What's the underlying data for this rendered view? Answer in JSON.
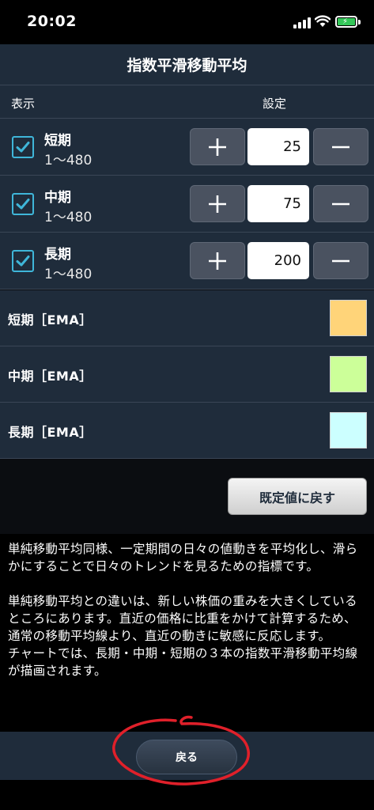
{
  "status": {
    "time": "20:02"
  },
  "title": "指数平滑移動平均",
  "header": {
    "show": "表示",
    "setting": "設定"
  },
  "periods": [
    {
      "name": "短期",
      "range": "1～480",
      "value": "25",
      "checked": true
    },
    {
      "name": "中期",
      "range": "1～480",
      "value": "75",
      "checked": true
    },
    {
      "name": "長期",
      "range": "1～480",
      "value": "200",
      "checked": true
    }
  ],
  "colors": [
    {
      "label": "短期［EMA］",
      "color": "#ffd479"
    },
    {
      "label": "中期［EMA］",
      "color": "#ccff99"
    },
    {
      "label": "長期［EMA］",
      "color": "#ccffff"
    }
  ],
  "default_button": "既定値に戻す",
  "description": {
    "p1": "単純移動平均同様、一定期間の日々の値動きを平均化し、滑らかにすることで日々のトレンドを見るための指標です。",
    "p2": "単純移動平均との違いは、新しい株価の重みを大きくしているところにあります。直近の価格に比重をかけて計算するため、通常の移動平均線より、直近の動きに敏感に反応します。",
    "p3": "チャートでは、長期・中期・短期の３本の指数平滑移動平均線が描画されます。"
  },
  "back_button": "戻る",
  "accent": {
    "checkbox": "#3fb6d9",
    "annotation": "#e0202a"
  }
}
